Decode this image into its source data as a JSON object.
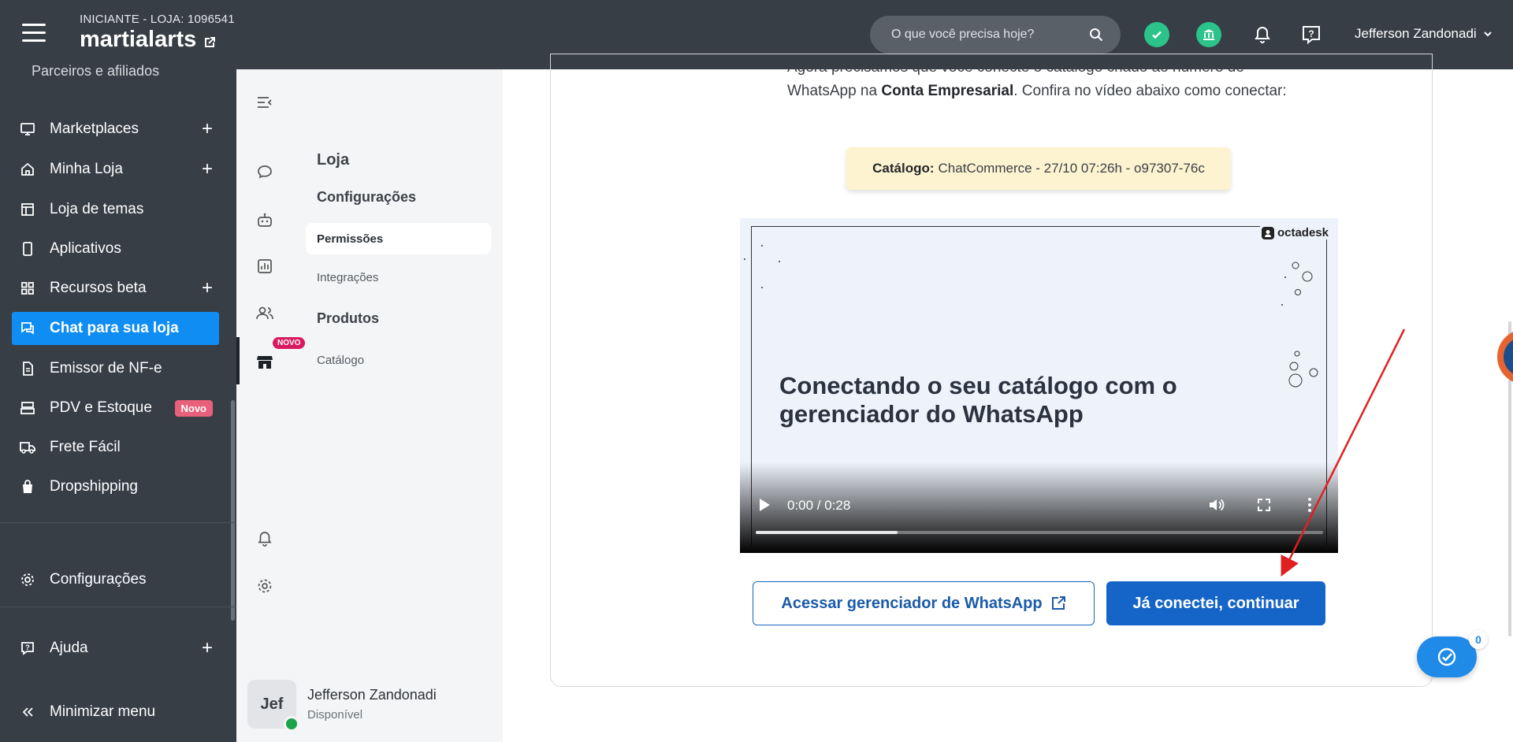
{
  "topbar": {
    "plan": "INICIANTE - LOJA: 1096541",
    "store_name": "martialarts",
    "search_placeholder": "O que você precisa hoje?",
    "user_name": "Jefferson Zandonadi"
  },
  "sidebar": {
    "partial_item": "Parceiros e afiliados",
    "items": [
      {
        "label": "Marketplaces",
        "icon": "monitor-icon",
        "plus": "+"
      },
      {
        "label": "Minha Loja",
        "icon": "home-icon",
        "plus": "+"
      },
      {
        "label": "Loja de temas",
        "icon": "layout-icon"
      },
      {
        "label": "Aplicativos",
        "icon": "mobile-icon"
      },
      {
        "label": "Recursos beta",
        "icon": "grid-icon",
        "plus": "+"
      },
      {
        "label": "Chat para sua loja",
        "icon": "chat-icon",
        "active": true
      },
      {
        "label": "Emissor de NF-e",
        "icon": "document-icon"
      },
      {
        "label": "PDV e Estoque",
        "icon": "register-icon",
        "badge": "Novo"
      },
      {
        "label": "Frete Fácil",
        "icon": "truck-icon"
      },
      {
        "label": "Dropshipping",
        "icon": "bag-icon"
      }
    ],
    "settings": "Configurações",
    "help": "Ajuda",
    "help_plus": "+",
    "minimize": "Minimizar menu"
  },
  "secondary": {
    "novo_badge": "NOVO",
    "heading_store": "Loja",
    "heading_config": "Configurações",
    "link_permissions": "Permissões",
    "link_integrations": "Integrações",
    "heading_products": "Produtos",
    "link_catalog": "Catálogo",
    "agent_initials": "Jef",
    "agent_name": "Jefferson Zandonadi",
    "agent_status": "Disponível"
  },
  "main": {
    "intro_part1": "Agora precisamos que você conecte o catálogo criado ao número de WhatsApp na ",
    "intro_bold": "Conta Empresarial",
    "intro_part2": ". Confira no vídeo abaixo como conectar:",
    "catalog_label": "Catálogo:",
    "catalog_value": "ChatCommerce - 27/10 07:26h - o97307-76c",
    "video_logo": "octadesk",
    "video_title": "Conectando o seu catálogo com o gerenciador do WhatsApp",
    "video_time": "0:00 / 0:28",
    "video_progress": 0.25,
    "btn_manager": "Acessar gerenciador de WhatsApp",
    "btn_continue": "Já conectei, continuar",
    "fab_count": "0"
  },
  "colors": {
    "topbar": "#373e46",
    "active": "#0f8df3",
    "primary_button": "#1565c8",
    "annotation_arrow": "#e02020"
  }
}
